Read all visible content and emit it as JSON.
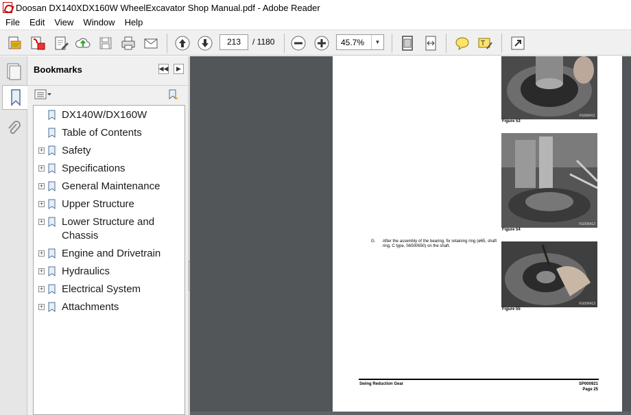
{
  "window": {
    "title": "Doosan DX140XDX160W WheelExcavator Shop Manual.pdf - Adobe Reader"
  },
  "menu": [
    "File",
    "Edit",
    "View",
    "Window",
    "Help"
  ],
  "toolbar": {
    "page_current": "213",
    "page_total": "/ 1180",
    "zoom": "45.7%",
    "icons": [
      "create-pdf-icon",
      "export-icon",
      "edit-icon",
      "upload-icon",
      "save-icon",
      "print-icon",
      "email-icon",
      "prev-page-icon",
      "next-page-icon",
      "zoom-out-icon",
      "zoom-in-icon",
      "fit-page-icon",
      "fit-width-icon",
      "comment-icon",
      "highlight-icon",
      "fullscreen-icon"
    ]
  },
  "bookmarks": {
    "header": "Bookmarks",
    "items": [
      {
        "label": "DX140W/DX160W",
        "expandable": false
      },
      {
        "label": "Table of Contents",
        "expandable": false
      },
      {
        "label": "Safety",
        "expandable": true
      },
      {
        "label": "Specifications",
        "expandable": true
      },
      {
        "label": "General Maintenance",
        "expandable": true
      },
      {
        "label": "Upper Structure",
        "expandable": true
      },
      {
        "label": "Lower Structure and Chassis",
        "expandable": true
      },
      {
        "label": "Engine and Drivetrain",
        "expandable": true
      },
      {
        "label": "Hydraulics",
        "expandable": true
      },
      {
        "label": "Electrical System",
        "expandable": true
      },
      {
        "label": "Attachments",
        "expandable": true
      }
    ]
  },
  "document": {
    "figures": [
      {
        "caption": "Figure 53",
        "code": "FG006411"
      },
      {
        "caption": "Figure 54",
        "code": "FG006412"
      },
      {
        "caption": "Figure 55",
        "code": "FG006413"
      }
    ],
    "step_letter": "G.",
    "step_text": "After the assembly of the bearing, fix retaining ring (ø65, shaft ring, C type, S6500650) on the shaft.",
    "footer_left": "Swing Reduction Gear",
    "footer_code": "SP000921",
    "footer_page": "Page 25"
  },
  "colors": {
    "doc_bg": "#525659",
    "toolbar_bg": "#f0f0f0",
    "accent_red": "#c00000"
  }
}
